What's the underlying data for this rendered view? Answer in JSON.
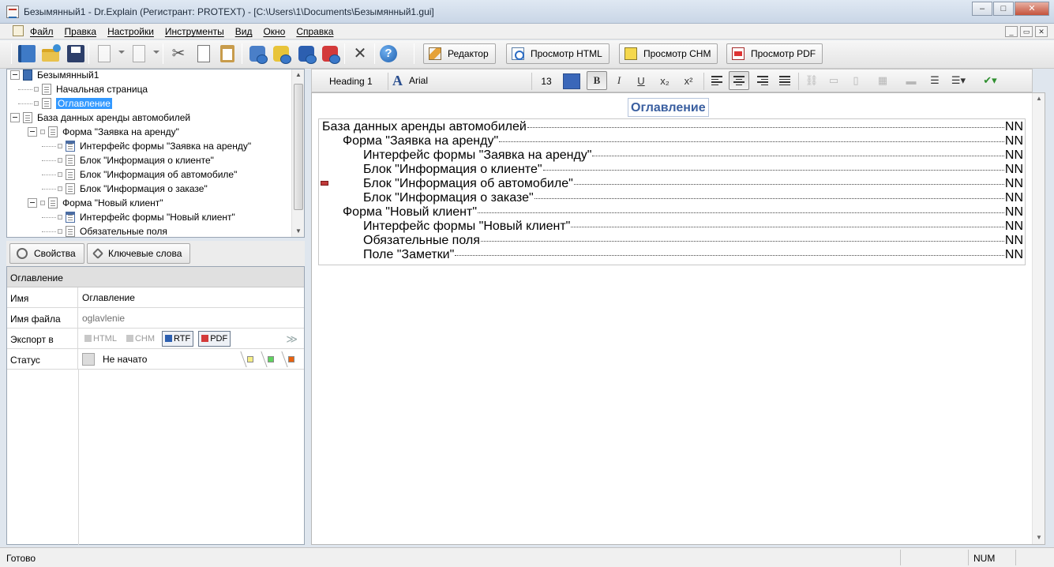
{
  "window": {
    "title": "Безымянный1 - Dr.Explain (Регистрант: PROTEXT) - [C:\\Users\\1\\Documents\\Безымянный1.gui]",
    "minimize": "–",
    "maximize": "□",
    "close": "✕"
  },
  "menu": {
    "items": [
      "Файл",
      "Правка",
      "Настройки",
      "Инструменты",
      "Вид",
      "Окно",
      "Справка"
    ],
    "mdi_minimize": "_",
    "mdi_restore": "▭",
    "mdi_close": "✕"
  },
  "toolbar": {
    "icons": [
      "book-icon",
      "open-folder-icon",
      "save-disk-icon",
      "add-topic-icon",
      "add-child-icon",
      "cut-icon",
      "copy-icon",
      "paste-icon",
      "export-html-icon",
      "export-chm-icon",
      "export-rtf-icon",
      "export-pdf-icon",
      "settings-tools-icon",
      "help-icon"
    ],
    "help_label": "?",
    "view_buttons": [
      "Редактор",
      "Просмотр HTML",
      "Просмотр CHM",
      "Просмотр PDF"
    ]
  },
  "tree": {
    "items": [
      {
        "label": "Безымянный1",
        "level": 0
      },
      {
        "label": "Начальная страница",
        "level": 1
      },
      {
        "label": "Оглавление",
        "level": 1,
        "selected": true
      },
      {
        "label": "База данных аренды автомобилей",
        "level": 1
      },
      {
        "label": "Форма \"Заявка на аренду\"",
        "level": 2
      },
      {
        "label": "Интерфейс формы \"Заявка на аренду\"",
        "level": 3
      },
      {
        "label": "Блок \"Информация о клиенте\"",
        "level": 3
      },
      {
        "label": "Блок \"Информация об автомобиле\"",
        "level": 3
      },
      {
        "label": "Блок \"Информация о заказе\"",
        "level": 3
      },
      {
        "label": "Форма \"Новый клиент\"",
        "level": 2
      },
      {
        "label": "Интерфейс формы \"Новый клиент\"",
        "level": 3
      },
      {
        "label": "Обязательные поля",
        "level": 3
      }
    ]
  },
  "props": {
    "tabs": [
      "Свойства",
      "Ключевые слова"
    ],
    "header": "Оглавление",
    "rows": {
      "name_key": "Имя",
      "name_val": "Оглавление",
      "file_key": "Имя файла",
      "file_val": "oglavlenie",
      "export_key": "Экспорт в",
      "export_html": "HTML",
      "export_chm": "CHM",
      "export_rtf": "RTF",
      "export_pdf": "PDF",
      "status_key": "Статус",
      "status_val": "Не начато"
    },
    "status_colors": [
      "#f6ee86",
      "#5fd35f",
      "#e9620f"
    ]
  },
  "format": {
    "style": "Heading 1",
    "font": "Arial",
    "font_icon": "A",
    "size": "13",
    "color": "#3a67b9",
    "bold": "B",
    "italic": "I",
    "underline": "U",
    "subscript": "x₂",
    "superscript": "x²"
  },
  "document": {
    "title": "Оглавление",
    "toc": [
      {
        "text": "База данных аренды автомобилей",
        "page": "NN",
        "indent": 0
      },
      {
        "text": "Форма \"Заявка на аренду\"",
        "page": "NN",
        "indent": 1
      },
      {
        "text": "Интерфейс формы \"Заявка на аренду\"",
        "page": "NN",
        "indent": 2
      },
      {
        "text": "Блок \"Информация о клиенте\"",
        "page": "NN",
        "indent": 2
      },
      {
        "text": "Блок \"Информация об автомобиле\"",
        "page": "NN",
        "indent": 2
      },
      {
        "text": "Блок \"Информация о заказе\"",
        "page": "NN",
        "indent": 2
      },
      {
        "text": "Форма \"Новый клиент\"",
        "page": "NN",
        "indent": 1
      },
      {
        "text": "Интерфейс формы \"Новый клиент\"",
        "page": "NN",
        "indent": 2
      },
      {
        "text": "Обязательные поля",
        "page": "NN",
        "indent": 2
      },
      {
        "text": "Поле \"Заметки\"",
        "page": "NN",
        "indent": 2
      }
    ]
  },
  "statusbar": {
    "text": "Готово",
    "num": "NUM"
  }
}
